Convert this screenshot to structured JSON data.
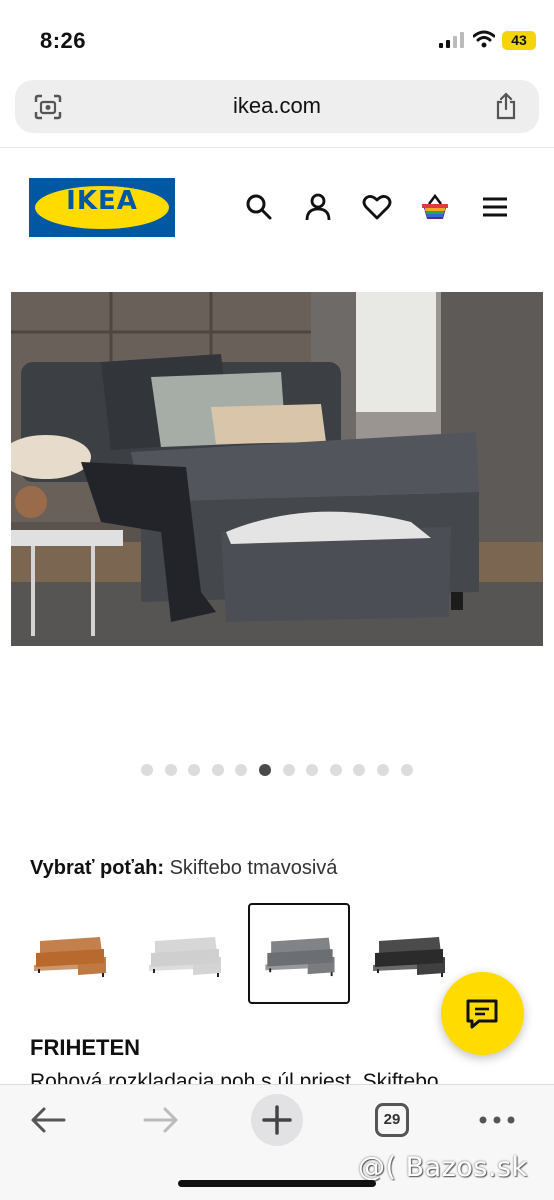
{
  "status_bar": {
    "time": "8:26",
    "battery": "43"
  },
  "browser": {
    "url": "ikea.com",
    "open_tabs": "29"
  },
  "header": {
    "logo_text": "IKEA"
  },
  "carousel": {
    "total_dots": 12,
    "active_index": 5
  },
  "product": {
    "select_label": "Vybrať poťah:",
    "selected_cover": "Skiftebo tmavosivá",
    "name": "FRIHETEN",
    "description": "Rohová rozkladacia poh s úl priest, Skiftebo"
  },
  "swatches": [
    {
      "color": "#b86a2e",
      "selected": false
    },
    {
      "color": "#cfcfcf",
      "selected": false
    },
    {
      "color": "#6b6e72",
      "selected": true
    },
    {
      "color": "#2b2b2b",
      "selected": false
    }
  ],
  "watermark": "@( Bazos.sk",
  "colors": {
    "ikea_blue": "#0058a3",
    "ikea_yellow": "#ffdb00"
  },
  "icons": [
    "camera-lens-icon",
    "share-icon",
    "search-icon",
    "user-icon",
    "heart-icon",
    "basket-icon",
    "menu-icon",
    "chat-icon",
    "back-icon",
    "forward-icon",
    "plus-icon",
    "tabs-icon",
    "more-icon"
  ]
}
